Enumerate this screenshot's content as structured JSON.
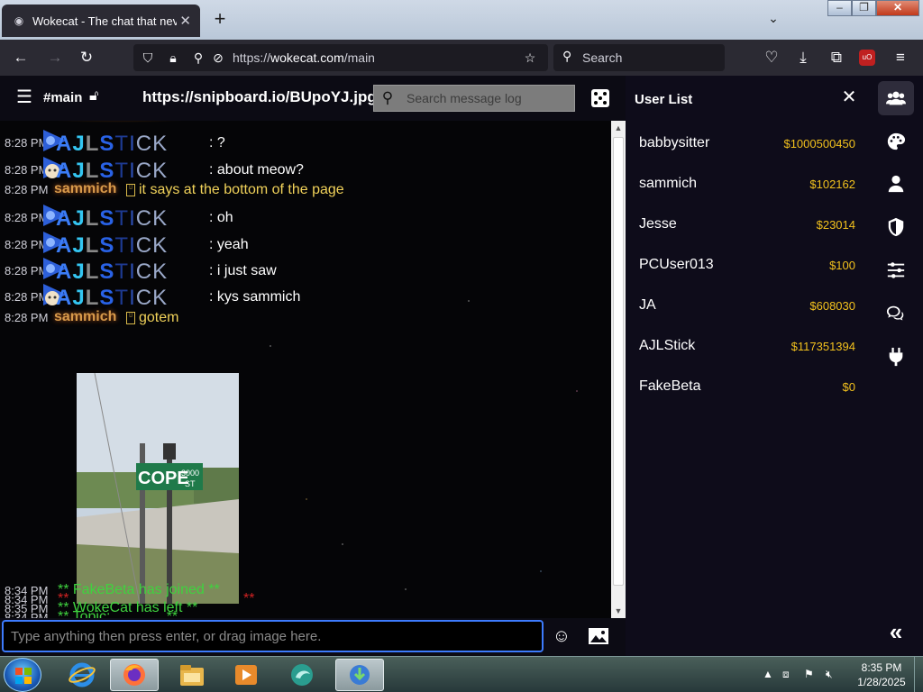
{
  "browser": {
    "tab_title": "Wokecat - The chat that never",
    "url_protocol": "https://",
    "url_host": "wokecat.com",
    "url_path": "/main",
    "search_placeholder": "Search"
  },
  "chat": {
    "channel": "#main",
    "link": "https://snipboard.io/BUpoYJ.jpg",
    "log_search_placeholder": "Search message log",
    "input_placeholder": "Type anything then press enter, or drag image here.",
    "messages": [
      {
        "time": "8:28 PM",
        "user": "AJLSTICK",
        "text": "?"
      },
      {
        "time": "8:28 PM",
        "user": "AJLSTICK",
        "text": "about meow?"
      },
      {
        "time": "8:28 PM",
        "user": "sammich",
        "text": "it says at the bottom of the page"
      },
      {
        "time": "8:28 PM",
        "user": "AJLSTICK",
        "text": "oh"
      },
      {
        "time": "8:28 PM",
        "user": "AJLSTICK",
        "text": "yeah"
      },
      {
        "time": "8:28 PM",
        "user": "AJLSTICK",
        "text": "i just saw"
      },
      {
        "time": "8:28 PM",
        "user": "AJLSTICK",
        "text": "kys sammich"
      },
      {
        "time": "8:28 PM",
        "user": "sammich",
        "text": "gotem"
      }
    ],
    "image_sign_text": "COPE",
    "image_sign_number": "3000",
    "image_sign_suffix": "ST",
    "system": [
      {
        "time": "8:34 PM",
        "text": "**",
        "style": "red"
      },
      {
        "time": "8:34 PM",
        "text": "** Topic: ______ **",
        "style": "green"
      },
      {
        "time": "8:34 PM",
        "text": "** FakeBeta has joined **",
        "style": "green"
      },
      {
        "time": "8:35 PM",
        "text": "** WokeCat has left **",
        "style": "green"
      }
    ]
  },
  "user_list": {
    "title": "User List",
    "users": [
      {
        "name": "babbysitter",
        "money": "$1000500450"
      },
      {
        "name": "sammich",
        "money": "$102162"
      },
      {
        "name": "Jesse",
        "money": "$23014"
      },
      {
        "name": "PCUser013",
        "money": "$100"
      },
      {
        "name": "JA",
        "money": "$608030"
      },
      {
        "name": "AJLStick",
        "money": "$117351394"
      },
      {
        "name": "FakeBeta",
        "money": "$0"
      }
    ]
  },
  "taskbar": {
    "time": "8:35 PM",
    "date": "1/28/2025"
  },
  "colors": {
    "accent_blue": "#3d7bfd",
    "money_yellow": "#f2c11d",
    "system_green": "#3fd23f"
  }
}
